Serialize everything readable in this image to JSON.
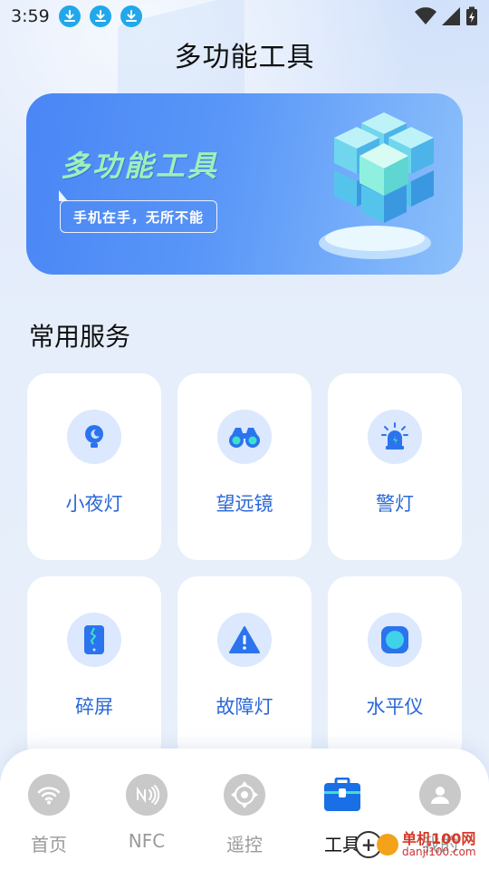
{
  "status_bar": {
    "time": "3:59",
    "notifications": [
      "download-icon",
      "download-icon",
      "download-icon"
    ],
    "right_icons": [
      "wifi-icon",
      "signal-icon",
      "battery-charging-icon"
    ]
  },
  "header": {
    "title": "多功能工具"
  },
  "banner": {
    "title": "多功能工具",
    "slogan": "手机在手，无所不能"
  },
  "section": {
    "title": "常用服务"
  },
  "services": [
    {
      "label": "小夜灯",
      "icon": "night-light-icon"
    },
    {
      "label": "望远镜",
      "icon": "binoculars-icon"
    },
    {
      "label": "警灯",
      "icon": "alarm-light-icon"
    },
    {
      "label": "碎屏",
      "icon": "broken-screen-icon"
    },
    {
      "label": "故障灯",
      "icon": "warning-triangle-icon"
    },
    {
      "label": "水平仪",
      "icon": "level-icon"
    }
  ],
  "bottom_nav": {
    "items": [
      {
        "label": "首页",
        "icon": "wifi-icon",
        "active": false
      },
      {
        "label": "NFC",
        "icon": "nfc-icon",
        "active": false
      },
      {
        "label": "遥控",
        "icon": "remote-icon",
        "active": false
      },
      {
        "label": "工具",
        "icon": "toolbox-icon",
        "active": true
      },
      {
        "label": "我的",
        "icon": "user-icon",
        "active": false
      }
    ]
  },
  "watermark": {
    "name": "单机100网",
    "url": "danji100.com"
  },
  "colors": {
    "accent": "#2a68d8",
    "banner_start": "#4a86f5",
    "banner_end": "#8cc0fb",
    "green_title": "#9ef0b9"
  }
}
